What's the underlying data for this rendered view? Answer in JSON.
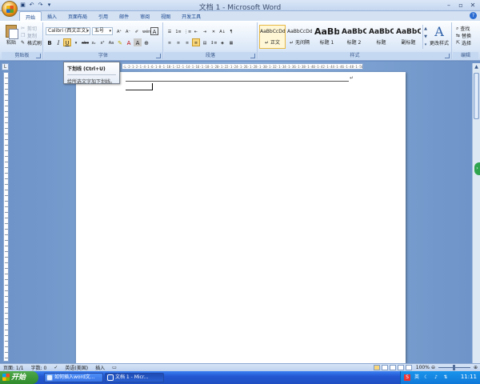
{
  "window": {
    "title": "文档 1 - Microsoft Word"
  },
  "qat": [
    "save-icon",
    "undo-icon",
    "redo-icon",
    "customize-icon"
  ],
  "tabs": [
    "开始",
    "插入",
    "页面布局",
    "引用",
    "邮件",
    "审阅",
    "视图",
    "开发工具"
  ],
  "active_tab": "开始",
  "clipboard": {
    "paste": "粘贴",
    "cut": "剪切",
    "copy": "复制",
    "format_painter": "格式刷",
    "label": "剪贴板"
  },
  "font": {
    "name": "Calibri (西文正文)",
    "size": "五号",
    "label": "字体"
  },
  "paragraph": {
    "label": "段落"
  },
  "styles": {
    "label": "样式",
    "items": [
      {
        "preview": "AaBbCcDd",
        "name": "↵ 正文"
      },
      {
        "preview": "AaBbCcDd",
        "name": "↵ 无间隔"
      },
      {
        "preview": "AaBb",
        "name": "标题 1"
      },
      {
        "preview": "AaBbC",
        "name": "标题 2"
      },
      {
        "preview": "AaBbC",
        "name": "标题"
      },
      {
        "preview": "AaBbC",
        "name": "副标题"
      }
    ],
    "change_styles": "更改样式"
  },
  "editing": {
    "label": "编辑",
    "find": "查找",
    "replace": "替换",
    "select": "选择"
  },
  "tooltip": {
    "title": "下划线 (Ctrl+U)",
    "description": "给所选文字加下划线。"
  },
  "ruler": {
    "text": "·L·2·1·2·1·4·1·6·1·8·1·10·1·12·1·14·1·16·1·18·1·20·1·22·1·24·1·26·1·28·1·30·1·32·1·34·1·36·1·38·1·40·1·42·1·44·1·46·1·48·1·50·1·52·1·54·1·56·1·58"
  },
  "statusbar": {
    "page": "页面: 1/1",
    "words": "字数: 0",
    "language": "英语(美国)",
    "mode": "插入",
    "zoom": "100%"
  },
  "taskbar": {
    "start": "开始",
    "items": [
      "如何插入word文...",
      "文档 1 - Micr..."
    ],
    "clock": "11:11"
  }
}
